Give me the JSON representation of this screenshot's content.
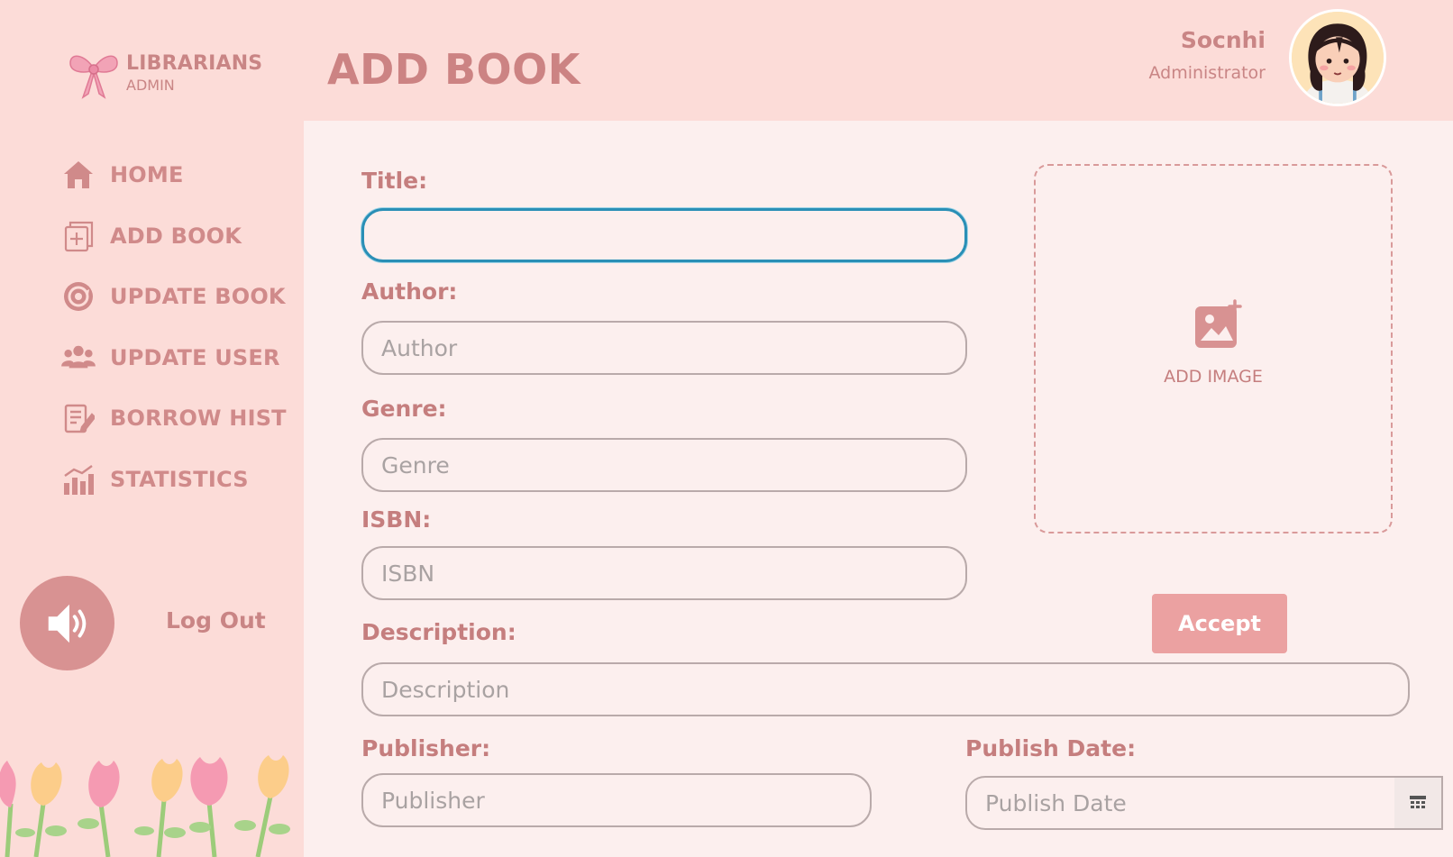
{
  "brand": {
    "title": "LIBRARIANS",
    "subtitle": "ADMIN"
  },
  "header": {
    "page_title": "ADD BOOK"
  },
  "user": {
    "name": "Socnhi",
    "role": "Administrator"
  },
  "sidebar": {
    "items": [
      {
        "label": "HOME",
        "icon": "home-icon"
      },
      {
        "label": "ADD BOOK",
        "icon": "add-book-icon"
      },
      {
        "label": "UPDATE BOOK",
        "icon": "update-icon"
      },
      {
        "label": "UPDATE USER",
        "icon": "users-icon"
      },
      {
        "label": "BORROW HIST",
        "icon": "history-icon"
      },
      {
        "label": "STATISTICS",
        "icon": "statistics-icon"
      }
    ],
    "logout_label": "Log Out",
    "speaker_icon": "speaker-icon"
  },
  "form": {
    "title": {
      "label": "Title:",
      "value": "",
      "placeholder": ""
    },
    "author": {
      "label": "Author:",
      "value": "",
      "placeholder": "Author"
    },
    "genre": {
      "label": "Genre:",
      "value": "",
      "placeholder": "Genre"
    },
    "isbn": {
      "label": "ISBN:",
      "value": "",
      "placeholder": "ISBN"
    },
    "description": {
      "label": "Description:",
      "value": "",
      "placeholder": "Description"
    },
    "publisher": {
      "label": "Publisher:",
      "value": "",
      "placeholder": "Publisher"
    },
    "publish_date": {
      "label": "Publish Date:",
      "value": "",
      "placeholder": "Publish Date"
    }
  },
  "image_upload": {
    "label": "ADD IMAGE"
  },
  "actions": {
    "accept_label": "Accept"
  },
  "colors": {
    "sidebar_bg": "#fcdcd8",
    "panel_bg": "#fcefee",
    "accent": "#c98585",
    "button": "#eba1a1",
    "focus": "#2a8fb6"
  }
}
